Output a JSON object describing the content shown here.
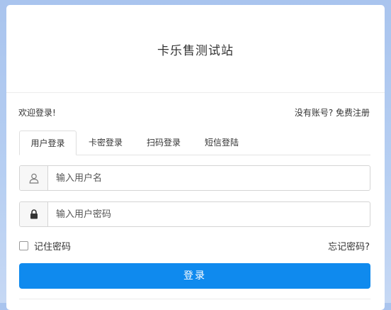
{
  "site": {
    "title": "卡乐售测试站"
  },
  "header": {
    "welcome": "欢迎登录!",
    "register": "没有账号? 免费注册"
  },
  "tabs": [
    {
      "label": "用户登录",
      "active": true
    },
    {
      "label": "卡密登录",
      "active": false
    },
    {
      "label": "扫码登录",
      "active": false
    },
    {
      "label": "短信登陆",
      "active": false
    }
  ],
  "form": {
    "username": {
      "placeholder": "输入用户名",
      "value": "",
      "icon": "user-icon"
    },
    "password": {
      "placeholder": "输入用户密码",
      "value": "",
      "icon": "lock-icon"
    },
    "remember_label": "记住密码",
    "remember_checked": false,
    "forgot_label": "忘记密码?",
    "submit_label": "登录"
  },
  "colors": {
    "primary": "#0f8aee",
    "background": "#b7cff2"
  }
}
